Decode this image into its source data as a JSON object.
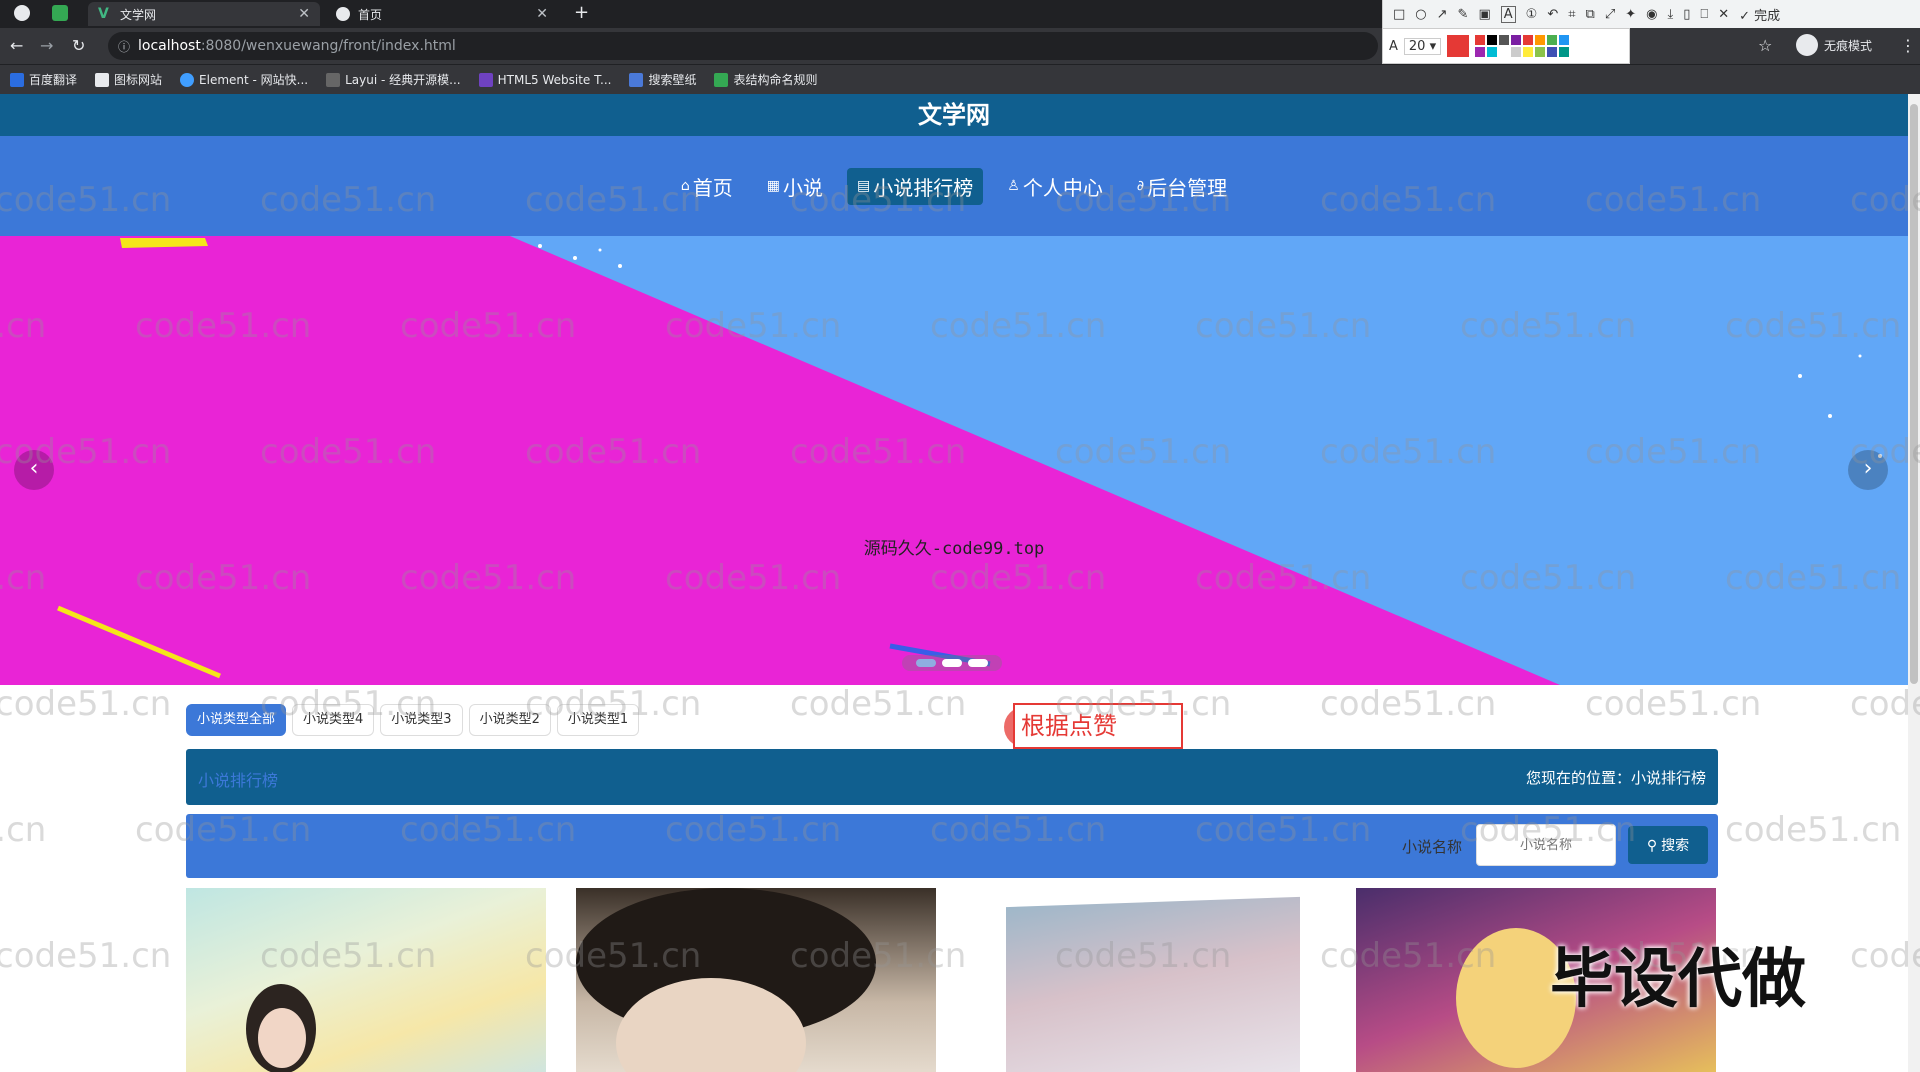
{
  "browser": {
    "tabs": [
      {
        "title": "文学网"
      },
      {
        "title": "首页"
      }
    ],
    "address": {
      "host": "localhost",
      "path": ":8080/wenxuewang/front/index.html"
    },
    "incognito_label": "无痕模式",
    "bookmarks": [
      "百度翻译",
      "图标网站",
      "Element - 网站快...",
      "Layui - 经典开源模...",
      "HTML5 Website T...",
      "搜索壁纸",
      "表结构命名规则"
    ]
  },
  "annotation_tool": {
    "done_label": "完成",
    "font_size": "20",
    "colors": [
      "#e53935",
      "#000000",
      "#555555",
      "#7b1fa2",
      "#e53935",
      "#ff9800",
      "#4caf50",
      "#2196f3",
      "#9c27b0",
      "#00bcd4",
      "#ffffff",
      "#cccccc",
      "#ffeb3b",
      "#8bc34a",
      "#3f51b5",
      "#009688"
    ]
  },
  "site": {
    "title": "文学网",
    "nav": [
      {
        "label": "首页",
        "icon": "home-icon",
        "glyph": "⌂"
      },
      {
        "label": "小说",
        "icon": "book-icon",
        "glyph": "▦"
      },
      {
        "label": "小说排行榜",
        "icon": "rank-icon",
        "glyph": "▤"
      },
      {
        "label": "个人中心",
        "icon": "user-icon",
        "glyph": "♙"
      },
      {
        "label": "后台管理",
        "icon": "link-icon",
        "glyph": "∂"
      }
    ],
    "active_nav": "小说排行榜"
  },
  "banner": {
    "caption": "源码久久-code99.top",
    "prev": "‹",
    "next": "›",
    "slide_count": 3,
    "current_slide": 1
  },
  "type_tabs": [
    "小说类型全部",
    "小说类型4",
    "小说类型3",
    "小说类型2",
    "小说类型1"
  ],
  "active_type": "小说类型全部",
  "annotation_note": "根据点赞",
  "rank_bar": {
    "title": "小说排行榜",
    "location": "您现在的位置：小说排行榜"
  },
  "search": {
    "label": "小说名称",
    "placeholder": "小说名称",
    "button": "搜索"
  },
  "watermark": "code51.cn",
  "promo_text": "毕设代做"
}
